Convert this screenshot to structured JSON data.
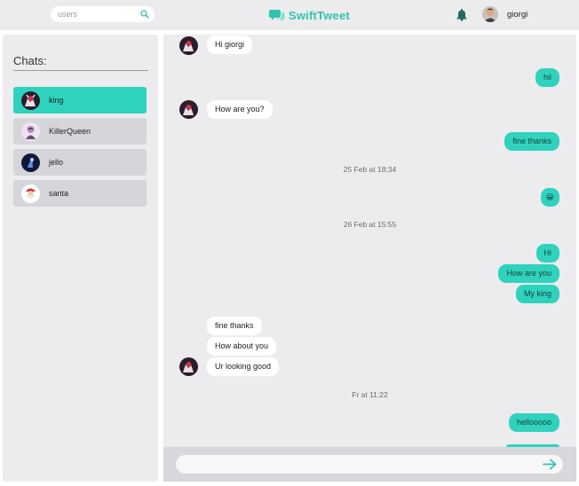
{
  "header": {
    "search_placeholder": "users",
    "brand": "SwiftTweet",
    "username": "giorgi"
  },
  "sidebar": {
    "title": "Chats:",
    "items": [
      {
        "label": "king",
        "active": true
      },
      {
        "label": "KillerQueen",
        "active": false
      },
      {
        "label": "jello",
        "active": false
      },
      {
        "label": "santa",
        "active": false
      }
    ]
  },
  "conversation": {
    "messages": [
      {
        "dir": "in",
        "text": "Hi giorgi"
      },
      {
        "dir": "out",
        "text": "hii"
      },
      {
        "dir": "in",
        "text": "How are you?"
      },
      {
        "dir": "out",
        "text": "fine thanks"
      },
      {
        "type": "date",
        "text": "25 Feb at 18:34"
      },
      {
        "dir": "out",
        "text": "😀"
      },
      {
        "type": "date",
        "text": "26 Feb at 15:55"
      },
      {
        "dir": "out",
        "text": "Hi"
      },
      {
        "dir": "out",
        "text": "How are you"
      },
      {
        "dir": "out",
        "text": "My king"
      },
      {
        "dir": "in",
        "text": "fine thanks"
      },
      {
        "dir": "in",
        "text": "How about you"
      },
      {
        "dir": "in",
        "text": "Ur looking good"
      },
      {
        "type": "date",
        "text": "Fr at 11:22"
      },
      {
        "dir": "out",
        "text": "hellooooo"
      }
    ]
  },
  "colors": {
    "accent": "#2fd3bd",
    "brand": "#2fc4ad",
    "panel": "#ececee",
    "bubble_in": "#ffffff"
  }
}
